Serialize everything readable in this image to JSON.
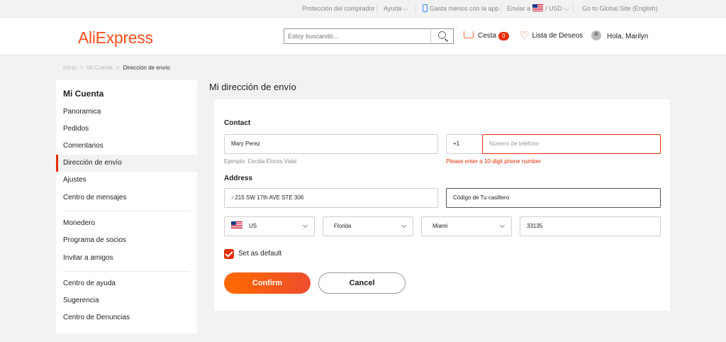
{
  "topbar": {
    "buyer_protection": "Protección del comprador",
    "help": "Ayuda",
    "app": "Gasta menos con la app",
    "ship_to": "Enviar a",
    "currency": "/ USD",
    "global_site": "Go to Global Site (English)"
  },
  "header": {
    "logo": "AliExpress",
    "search_placeholder": "Estoy buscando...",
    "cart_label": "Cesta",
    "cart_count": "0",
    "wishlist": "Lista de Deseos",
    "greeting": "Hola, Marilyn"
  },
  "breadcrumb": {
    "home": "Inicio",
    "account": "Mi Cuenta",
    "current": "Dirección de envío"
  },
  "sidebar": {
    "title": "Mi Cuenta",
    "items": [
      "Panoramica",
      "Pedidos",
      "Comentarios",
      "Dirección de envío",
      "Ajustes",
      "Centro de mensajes",
      "Monedero",
      "Programa de socios",
      "Invitar a amigos",
      "Centro de ayuda",
      "Sugerencia",
      "Centro de Denuncias"
    ],
    "active_index": 3
  },
  "page_title": "Mi dirección de envío",
  "form": {
    "contact_heading": "Contact",
    "name_value": "Mary Perez",
    "name_hint": "Ejemplo: Cecilia Elorza Vidal",
    "phone_prefix": "+1",
    "phone_placeholder": "Número de teléfono",
    "phone_error": "Please enter a 10-digit phone number",
    "address_heading": "Address",
    "address_value": "215 SW 17th AVE STE 306",
    "locker_value": "Código de Tu casillero",
    "country": "US",
    "state": "Florida",
    "city": "Miami",
    "zip": "33135",
    "default_label": "Set as default",
    "default_checked": true,
    "confirm_label": "Confirm",
    "cancel_label": "Cancel"
  },
  "colors": {
    "brand": "#ff4d1a",
    "error": "#e62e04",
    "confirm_gradient_start": "#ff6a00",
    "confirm_gradient_end": "#ee4d2d"
  }
}
